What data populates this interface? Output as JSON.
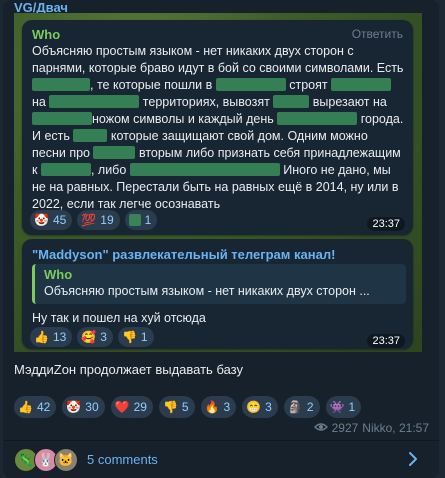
{
  "channel": {
    "name": "VG/Двач"
  },
  "post1": {
    "author": "Who",
    "reply_label": "Ответить",
    "text_segments": [
      "Объясняю простым языком - нет никаких двух сторон с парнями, которые браво идут в бой со своими символами. Есть ",
      ", те которые пошли в ",
      " строят ",
      " на ",
      " территориях, вывозят ",
      " вырезают на ",
      "ножом символы и каждый день ",
      " города. И есть ",
      " которые защищают свой дом. Одним можно песни про ",
      " вторым либо признать себя принадлежащим к ",
      ", либо ",
      " Иного не дано, мы не на равных. Перестали быть на равных ещё в 2014, ну или в 2022, если так легче осознавать"
    ],
    "reactions": [
      {
        "emoji": "🤡",
        "count": "45"
      },
      {
        "emoji": "💯",
        "count": "19"
      },
      {
        "emoji": "",
        "count": "1"
      }
    ],
    "time": "23:37"
  },
  "post2": {
    "forward_title": "\"Maddyson\" развлекательный телеграм канал!",
    "quote_author": "Who",
    "quote_text": "Объясняю простым языком - нет никаких двух сторон ...",
    "text": "Ну так и пошел на хуй отсюда",
    "reactions": [
      {
        "emoji": "👍",
        "count": "13"
      },
      {
        "emoji": "🥰",
        "count": "3"
      },
      {
        "emoji": "👎",
        "count": "1"
      }
    ],
    "time": "23:37"
  },
  "caption": "МэддиZон продолжает выдавать базу",
  "reactions": [
    {
      "emoji": "👍",
      "count": "42"
    },
    {
      "emoji": "🤡",
      "count": "30"
    },
    {
      "emoji": "❤️",
      "count": "29"
    },
    {
      "emoji": "👎",
      "count": "5"
    },
    {
      "emoji": "🔥",
      "count": "3"
    },
    {
      "emoji": "😁",
      "count": "3"
    },
    {
      "emoji": "🗿",
      "count": "2"
    },
    {
      "emoji": "👾",
      "count": "1"
    }
  ],
  "meta": {
    "views": "2927",
    "author_time": "Nikko, 21:57"
  },
  "comments": {
    "label": "5 comments",
    "avatars": [
      "🦎",
      "🐰",
      "🐱"
    ]
  },
  "colors": {
    "accent": "#6ab3f3",
    "author_green": "#7ccb5b",
    "bg": "#17212b"
  }
}
